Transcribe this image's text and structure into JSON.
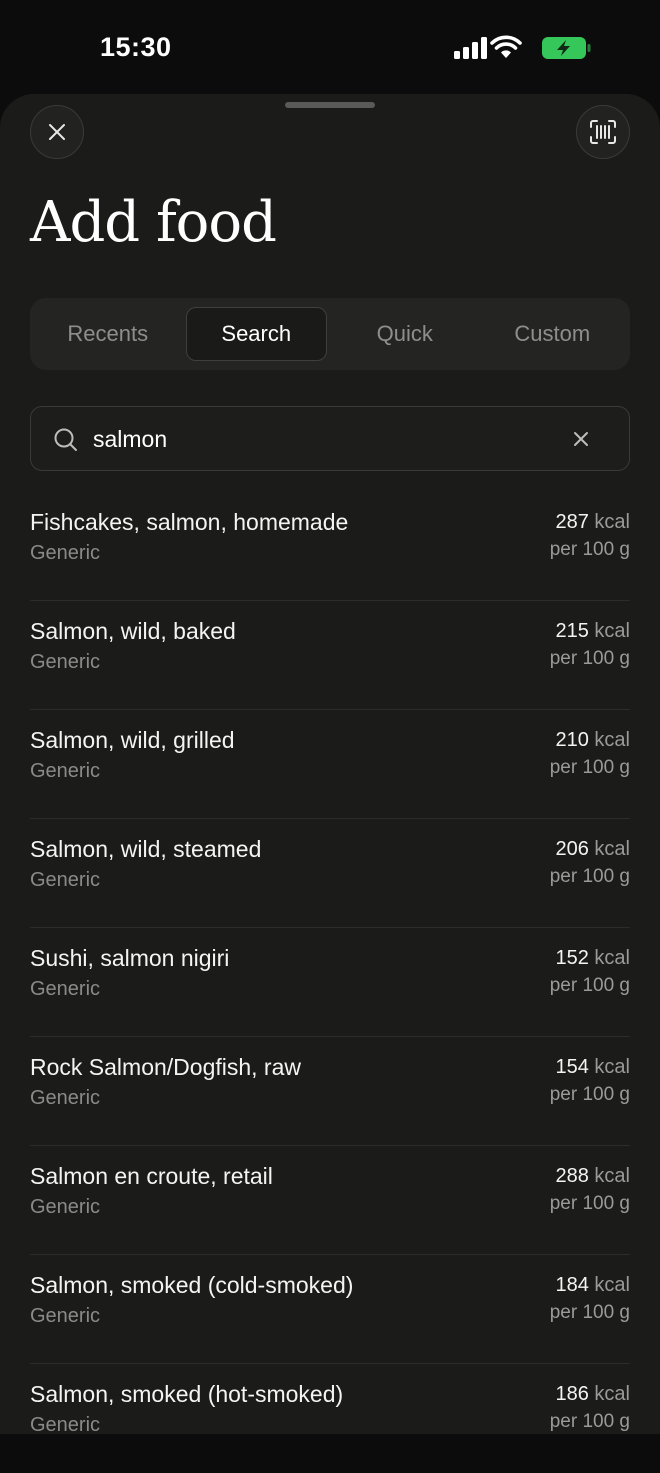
{
  "status_bar": {
    "time": "15:30",
    "icons": [
      "signal-icon",
      "wifi-icon",
      "battery-charging-icon"
    ],
    "battery_color": "#35c759"
  },
  "header": {
    "close_icon": "close-icon",
    "scan_icon": "barcode-scan-icon",
    "title": "Add food"
  },
  "tabs": [
    {
      "label": "Recents",
      "active": false
    },
    {
      "label": "Search",
      "active": true
    },
    {
      "label": "Quick",
      "active": false
    },
    {
      "label": "Custom",
      "active": false
    }
  ],
  "search": {
    "value": "salmon",
    "icon": "search-icon",
    "clear_icon": "clear-icon"
  },
  "results": [
    {
      "name": "Fishcakes, salmon, homemade",
      "source": "Generic",
      "kcal": "287",
      "unit": "kcal",
      "per": "per 100 g"
    },
    {
      "name": "Salmon, wild, baked",
      "source": "Generic",
      "kcal": "215",
      "unit": "kcal",
      "per": "per 100 g"
    },
    {
      "name": "Salmon, wild, grilled",
      "source": "Generic",
      "kcal": "210",
      "unit": "kcal",
      "per": "per 100 g"
    },
    {
      "name": "Salmon, wild, steamed",
      "source": "Generic",
      "kcal": "206",
      "unit": "kcal",
      "per": "per 100 g"
    },
    {
      "name": "Sushi, salmon nigiri",
      "source": "Generic",
      "kcal": "152",
      "unit": "kcal",
      "per": "per 100 g"
    },
    {
      "name": "Rock Salmon/Dogfish, raw",
      "source": "Generic",
      "kcal": "154",
      "unit": "kcal",
      "per": "per 100 g"
    },
    {
      "name": "Salmon en croute, retail",
      "source": "Generic",
      "kcal": "288",
      "unit": "kcal",
      "per": "per 100 g"
    },
    {
      "name": "Salmon, smoked (cold-smoked)",
      "source": "Generic",
      "kcal": "184",
      "unit": "kcal",
      "per": "per 100 g"
    },
    {
      "name": "Salmon, smoked (hot-smoked)",
      "source": "Generic",
      "kcal": "186",
      "unit": "kcal",
      "per": "per 100 g"
    }
  ]
}
